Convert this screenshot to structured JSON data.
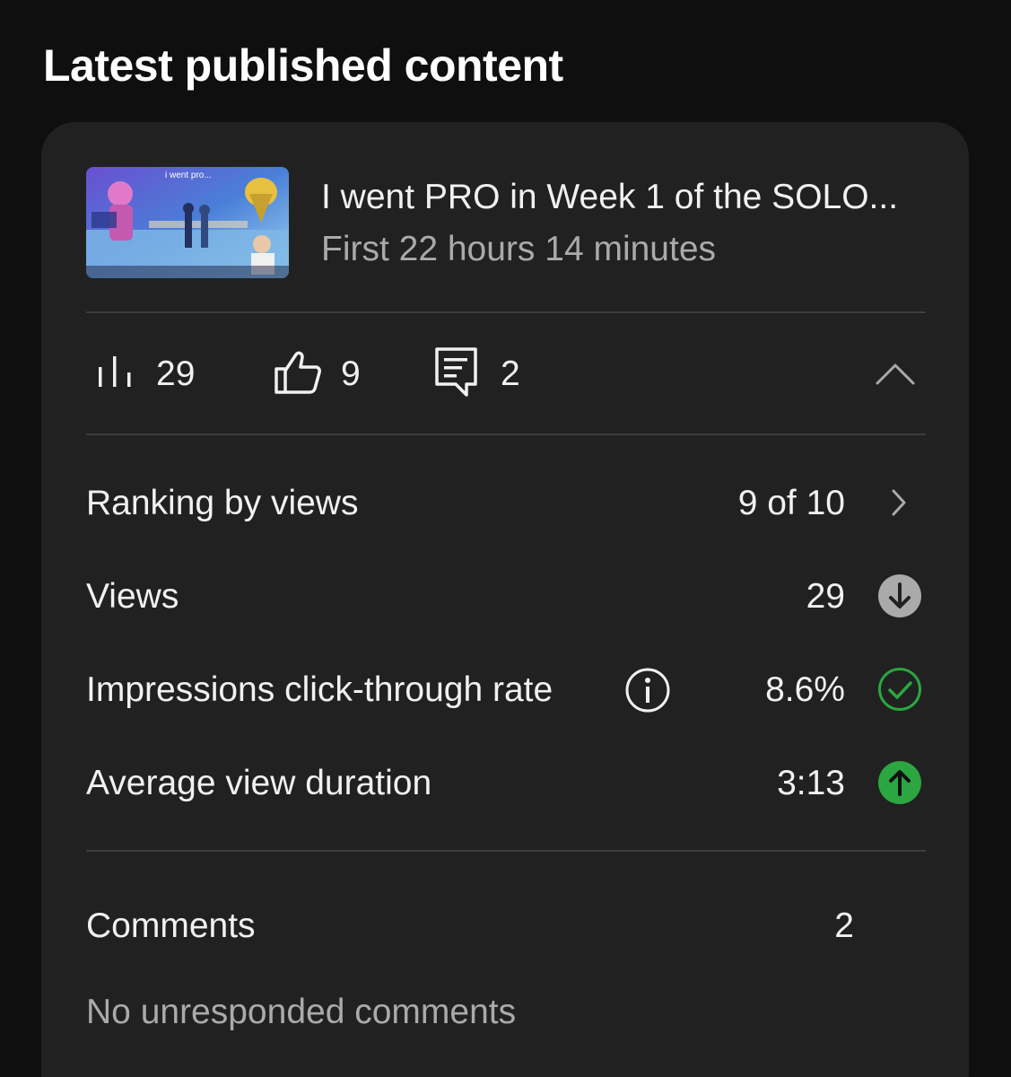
{
  "section": {
    "title": "Latest published content"
  },
  "video": {
    "title": "I went PRO in Week 1 of the SOLO...",
    "subtitle": "First 22 hours 14 minutes",
    "thumbnail_caption": "i went pro..."
  },
  "stats": {
    "views": "29",
    "likes": "9",
    "comments": "2",
    "icons": [
      "bar-chart-icon",
      "thumbs-up-icon",
      "comment-icon",
      "chevron-up-icon"
    ]
  },
  "metrics": [
    {
      "label": "Ranking by views",
      "value": "9 of 10",
      "trail_icon": "chevron-right-icon"
    },
    {
      "label": "Views",
      "value": "29",
      "trail_icon": "arrow-down-circle-icon"
    },
    {
      "label": "Impressions click-through rate",
      "value": "8.6%",
      "trail_icon": "check-circle-icon"
    },
    {
      "label": "Average view duration",
      "value": "3:13",
      "trail_icon": "arrow-up-circle-icon"
    }
  ],
  "comments": {
    "label": "Comments",
    "value": "2",
    "status": "No unresponded comments"
  },
  "colors": {
    "background": "#0f0f0f",
    "card": "#212121",
    "divider": "#3d3d3d",
    "text": "#f1f1f1",
    "secondary_text": "#aaaaaa",
    "success_green": "#2ba640",
    "neutral_badge": "#aaaaaa"
  }
}
